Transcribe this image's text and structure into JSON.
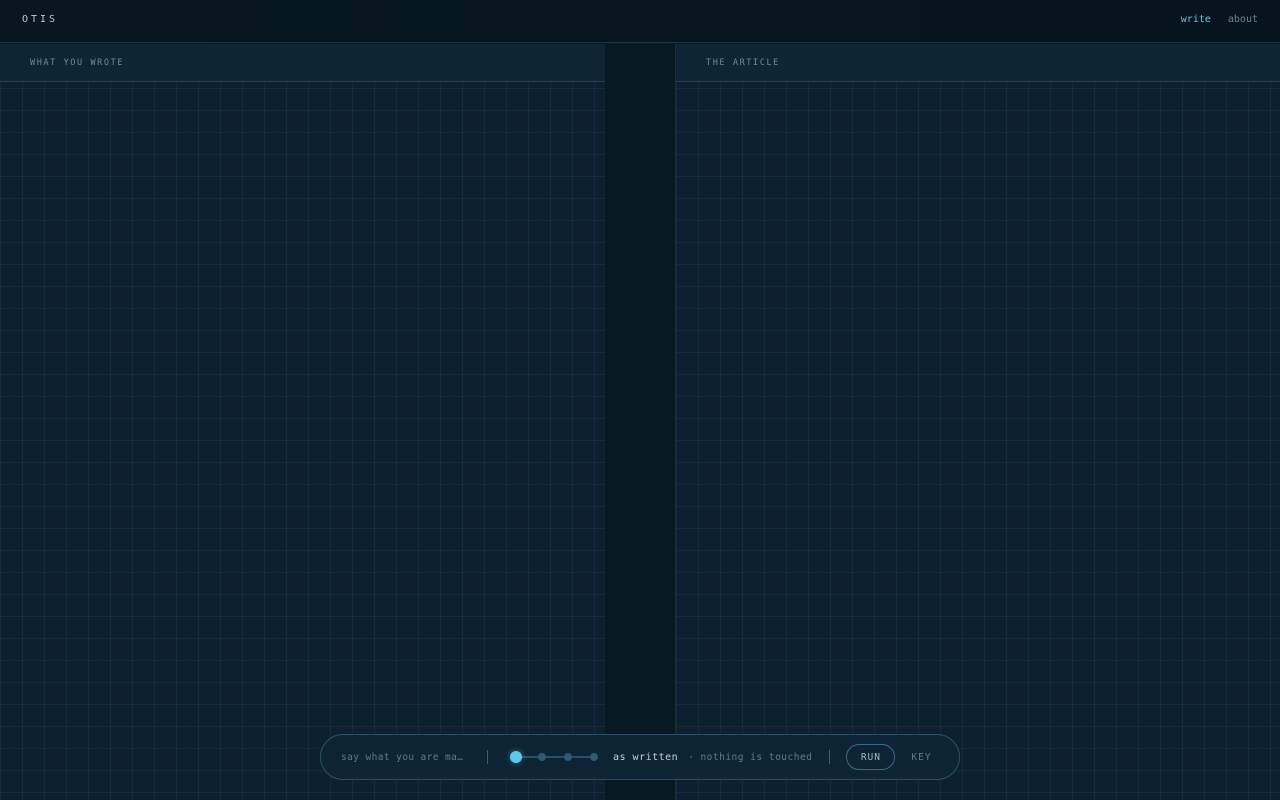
{
  "app": {
    "brand": "OTIS"
  },
  "nav": {
    "write": "write",
    "about": "about"
  },
  "left_pane": {
    "title": "WHAT YOU WROTE"
  },
  "right_pane": {
    "title": "THE ARTICLE"
  },
  "dock": {
    "prompt_placeholder": "say what you are ma…",
    "level": {
      "current": 0,
      "stops": 4,
      "label": "as written",
      "description": "nothing is touched"
    },
    "run_label": "RUN",
    "key_label": "KEY"
  },
  "colors": {
    "accent": "#5fc6ea",
    "background": "#0a1b26",
    "panel": "#0c2030"
  }
}
